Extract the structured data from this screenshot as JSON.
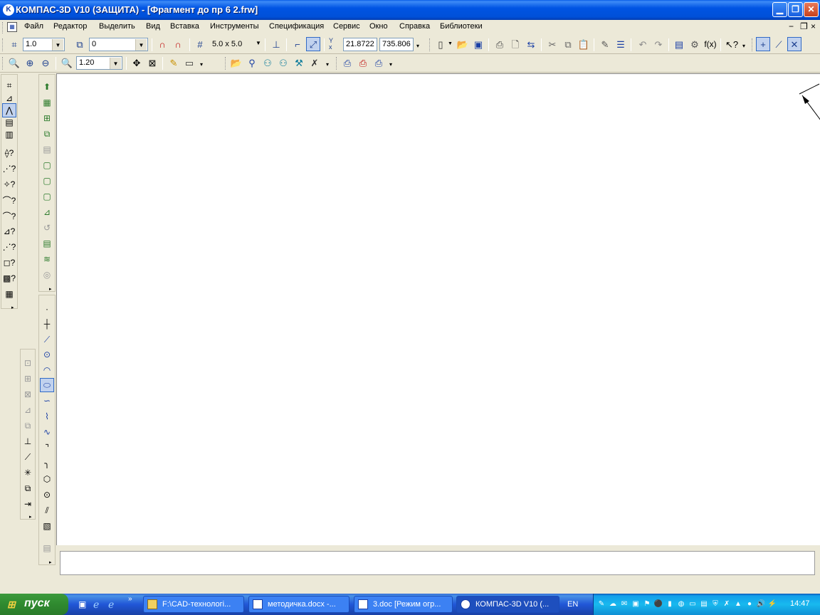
{
  "window": {
    "app_icon": "K",
    "title": "КОМПАС-3D V10 (ЗАЩИТА) - [Фрагмент до пр 6  2.frw]",
    "minimize_icon": "minimize-icon",
    "maximize_icon": "restore-icon",
    "close_icon": "close-icon"
  },
  "menu": {
    "items": [
      "Файл",
      "Редактор",
      "Выделить",
      "Вид",
      "Вставка",
      "Инструменты",
      "Спецификация",
      "Сервис",
      "Окно",
      "Справка",
      "Библиотеки"
    ]
  },
  "toolbar1": {
    "scale_value": "1.0",
    "layer_value": "0",
    "grid_value": "5.0 x 5.0",
    "coord_x": "21.8722",
    "coord_y": "735.806",
    "coord_label": "Y\nx"
  },
  "toolbar2": {
    "zoom_value": "1.20"
  },
  "taskbar": {
    "start_label": "пуск",
    "tasks": [
      {
        "label": "F:\\CAD-технологі...",
        "active": false
      },
      {
        "label": "методичка.docx -...",
        "active": false
      },
      {
        "label": "3.doc [Режим огр...",
        "active": false
      },
      {
        "label": "КОМПАС-3D V10 (...",
        "active": true
      }
    ],
    "language": "EN",
    "clock": "14:47"
  },
  "colors": {
    "title_bar": "#0054e3",
    "background": "#ece9d8",
    "canvas": "#ffffff",
    "taskbar": "#245edb",
    "start": "#2f8a2f",
    "tray": "#139ee9"
  }
}
